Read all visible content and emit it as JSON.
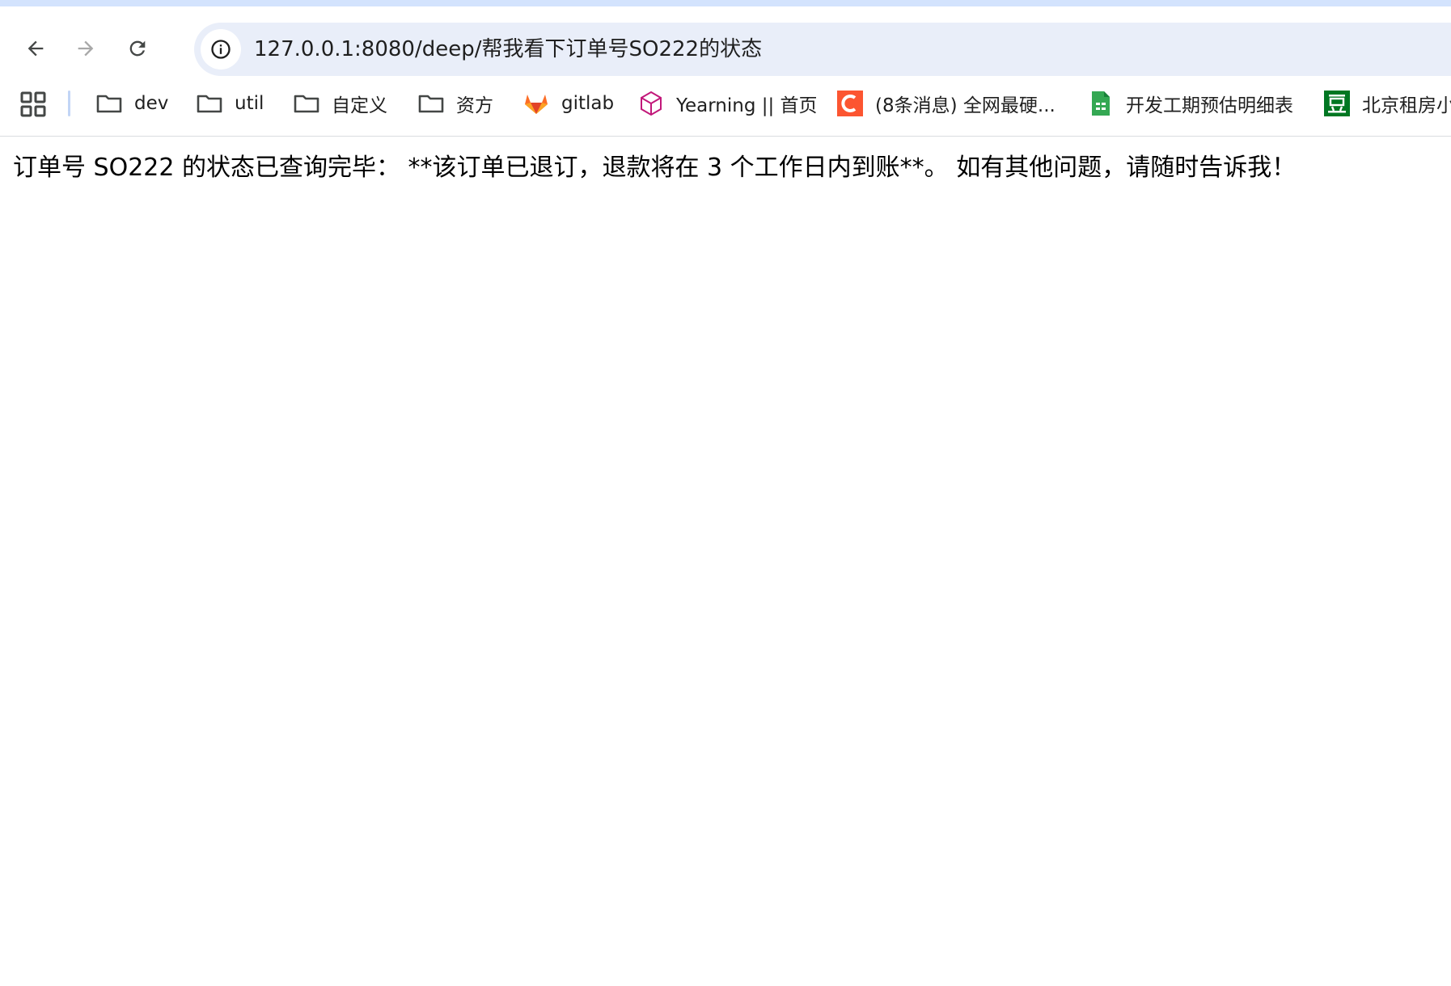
{
  "browser": {
    "url": "127.0.0.1:8080/deep/帮我看下订单号SO222的状态",
    "nav": {
      "back_icon": "arrow-left-icon",
      "forward_icon": "arrow-right-icon",
      "reload_icon": "reload-icon",
      "site_info_icon": "info-circle-icon"
    },
    "colors": {
      "frame": "#d3e3fd",
      "omnibox": "#e9eef9",
      "gitlab": "#e24329",
      "csdn": "#fc5531",
      "sheets": "#34a853",
      "douban": "#007722",
      "yearning": "#c2187a"
    }
  },
  "bookmarks": {
    "apps_icon": "apps-grid-icon",
    "items": [
      {
        "label": "dev",
        "icon": "folder-icon"
      },
      {
        "label": "util",
        "icon": "folder-icon"
      },
      {
        "label": "自定义",
        "icon": "folder-icon"
      },
      {
        "label": "资方",
        "icon": "folder-icon"
      },
      {
        "label": "gitlab",
        "icon": "gitlab-icon"
      },
      {
        "label": "Yearning || 首页",
        "icon": "yearning-icon"
      },
      {
        "label": "(8条消息) 全网最硬...",
        "icon": "csdn-icon"
      },
      {
        "label": "开发工期预估明细表",
        "icon": "spreadsheet-icon"
      },
      {
        "label": "北京租房小",
        "icon": "douban-icon"
      }
    ]
  },
  "page": {
    "message": "订单号 SO222 的状态已查询完毕： **该订单已退订，退款将在 3 个工作日内到账**。 如有其他问题，请随时告诉我！"
  }
}
